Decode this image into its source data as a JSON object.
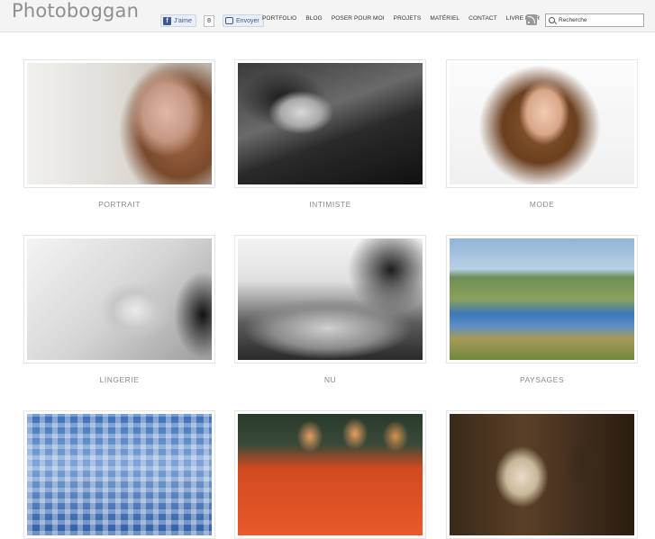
{
  "header": {
    "logo": "Photoboggan",
    "fb_like_label": "J'aime",
    "fb_like_count": "8",
    "fb_send_label": "Envoyer",
    "search_placeholder": "Recherche"
  },
  "nav": {
    "items": [
      "PORTFOLIO",
      "BLOG",
      "POSER POUR MOI",
      "PROJETS",
      "MATÉRIEL",
      "CONTACT",
      "LIVRE D'OR"
    ]
  },
  "gallery": {
    "items": [
      {
        "caption": "PORTRAIT"
      },
      {
        "caption": "INTIMISTE"
      },
      {
        "caption": "MODE"
      },
      {
        "caption": "LINGERIE"
      },
      {
        "caption": "NU"
      },
      {
        "caption": "PAYSAGES"
      },
      {
        "caption": ""
      },
      {
        "caption": ""
      },
      {
        "caption": ""
      }
    ]
  },
  "colors": {
    "header_bg": "#f4f4f4",
    "logo": "#8f8f8f",
    "caption": "#8a8a8a",
    "facebook": "#3b5998"
  }
}
